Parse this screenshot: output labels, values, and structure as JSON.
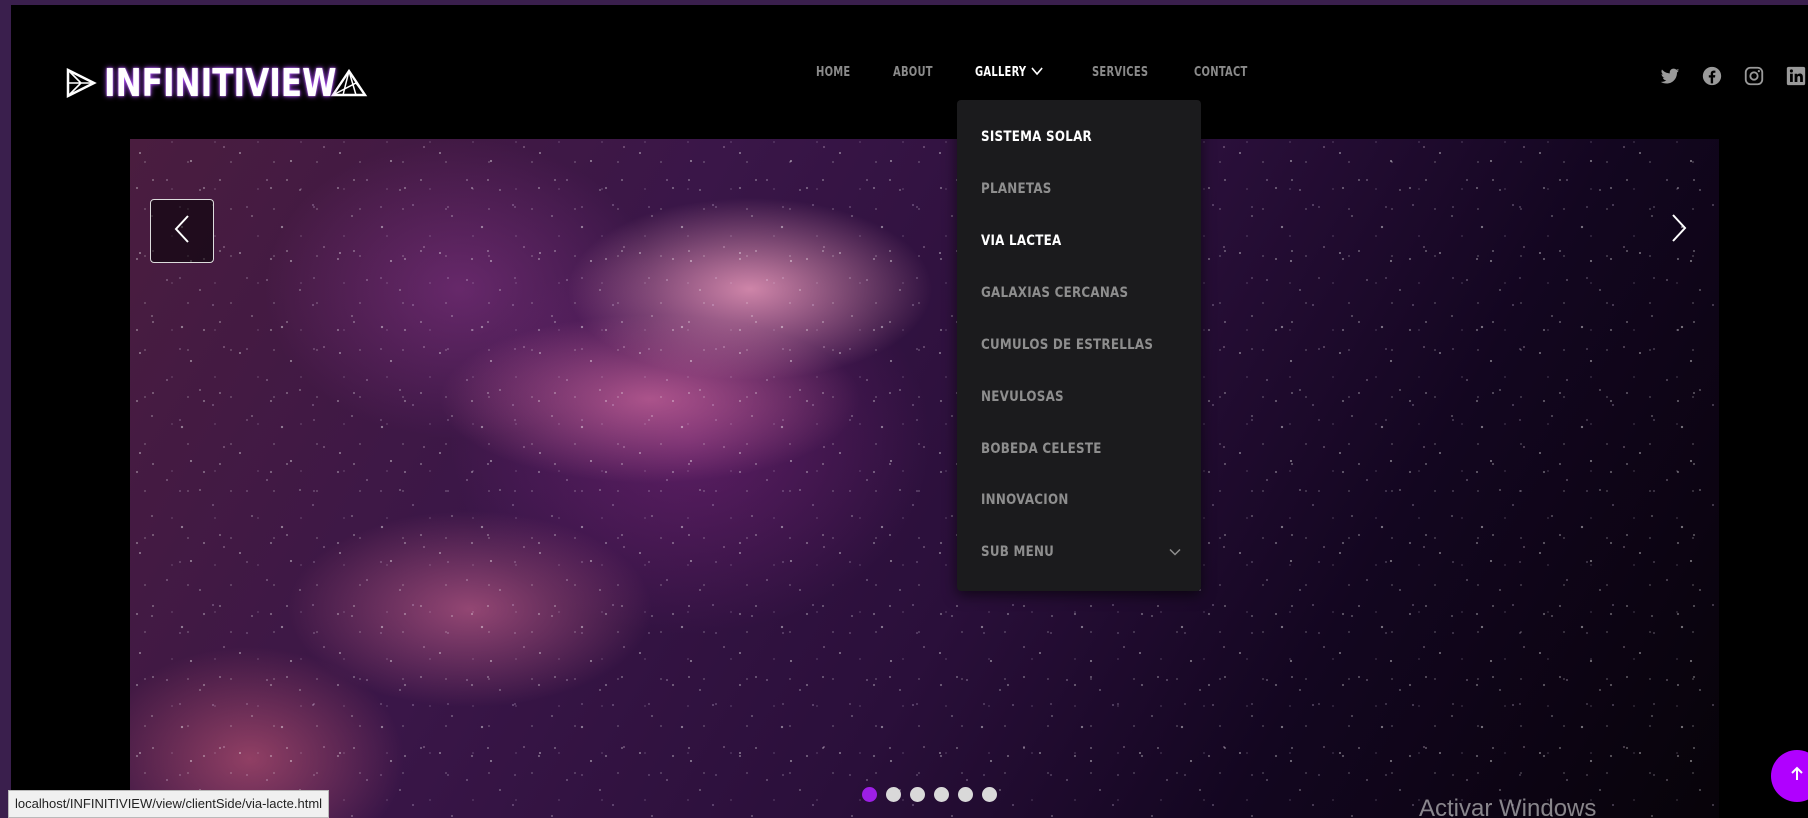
{
  "brand": {
    "name": "INFINITIVIEW"
  },
  "nav": {
    "items": [
      {
        "label": "HOME"
      },
      {
        "label": "ABOUT"
      },
      {
        "label": "GALLERY"
      },
      {
        "label": "SERVICES"
      },
      {
        "label": "CONTACT"
      }
    ],
    "active": "GALLERY"
  },
  "social": [
    "twitter-icon",
    "facebook-icon",
    "instagram-icon",
    "linkedin-icon"
  ],
  "gallery_dropdown": {
    "items": [
      {
        "label": "SISTEMA SOLAR"
      },
      {
        "label": "PLANETAS"
      },
      {
        "label": "VIA LACTEA"
      },
      {
        "label": "GALAXIAS CERCANAS"
      },
      {
        "label": "CUMULOS DE ESTRELLAS"
      },
      {
        "label": "NEVULOSAS"
      },
      {
        "label": "BOBEDA CELESTE"
      },
      {
        "label": "INNOVACION"
      },
      {
        "label": "SUB MENU"
      }
    ]
  },
  "carousel": {
    "slide_count": 6,
    "active_index": 0
  },
  "status_bar": {
    "url": "localhost/INFINITIVIEW/view/clientSide/via-lacte.html"
  },
  "watermark": {
    "text": "Activar Windows"
  },
  "colors": {
    "accent": "#9d1fe6",
    "to_top": "#b000ff",
    "dropdown_bg": "#1b1b1d"
  }
}
